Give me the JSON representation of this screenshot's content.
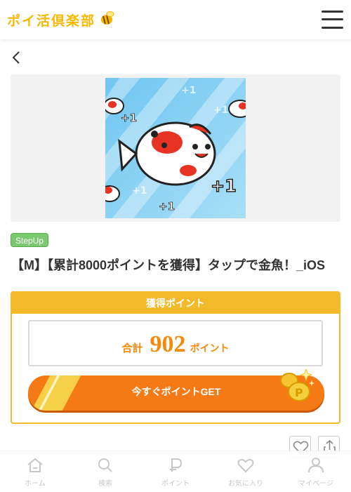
{
  "header": {
    "logo_text": "ポイ活倶楽部",
    "logo_bee": "bee-icon",
    "menu_icon": "hamburger-icon"
  },
  "nav": {
    "back_icon": "chevron-left-icon"
  },
  "banner": {
    "alt": "fish-game-banner"
  },
  "offer": {
    "badge": "StepUp",
    "title": "【M】【累計8000ポイントを獲得】タップで金魚！_iOS"
  },
  "points": {
    "heading": "獲得ポイント",
    "total_label": "合計",
    "total_value": "902",
    "total_unit": "ポイント",
    "cta_label": "今すぐポイントGET"
  },
  "actions": {
    "favorite_icon": "heart-icon",
    "share_icon": "share-icon"
  },
  "tabbar": {
    "items": [
      {
        "label": "ホーム",
        "icon": "home-icon"
      },
      {
        "label": "検索",
        "icon": "search-icon"
      },
      {
        "label": "ポイント",
        "icon": "point-icon"
      },
      {
        "label": "お気に入り",
        "icon": "heart-icon"
      },
      {
        "label": "マイページ",
        "icon": "person-icon"
      }
    ]
  },
  "colors": {
    "accent": "#f2b928",
    "cta": "#f57a15",
    "points_text": "#f58a0a",
    "badge": "#7bc96f"
  }
}
